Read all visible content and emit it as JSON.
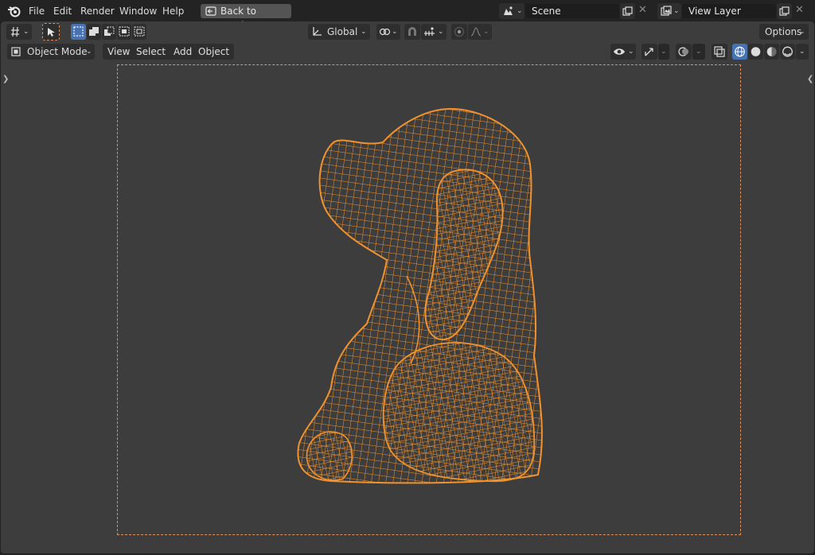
{
  "topbar": {
    "menus": [
      "File",
      "Edit",
      "Render",
      "Window",
      "Help"
    ],
    "back_button": "Back to Previous",
    "scene_value": "Scene",
    "view_layer_value": "View Layer"
  },
  "tool_header": {
    "orientation": "Global",
    "options": "Options"
  },
  "view_header": {
    "mode": "Object Mode",
    "menus": [
      "View",
      "Select",
      "Add",
      "Object"
    ]
  },
  "viewport": {
    "object": "wireframe dog sculpture",
    "wire_color": "#f0922e",
    "background": "#3d3d3d",
    "frame_color": "#e0905a"
  }
}
